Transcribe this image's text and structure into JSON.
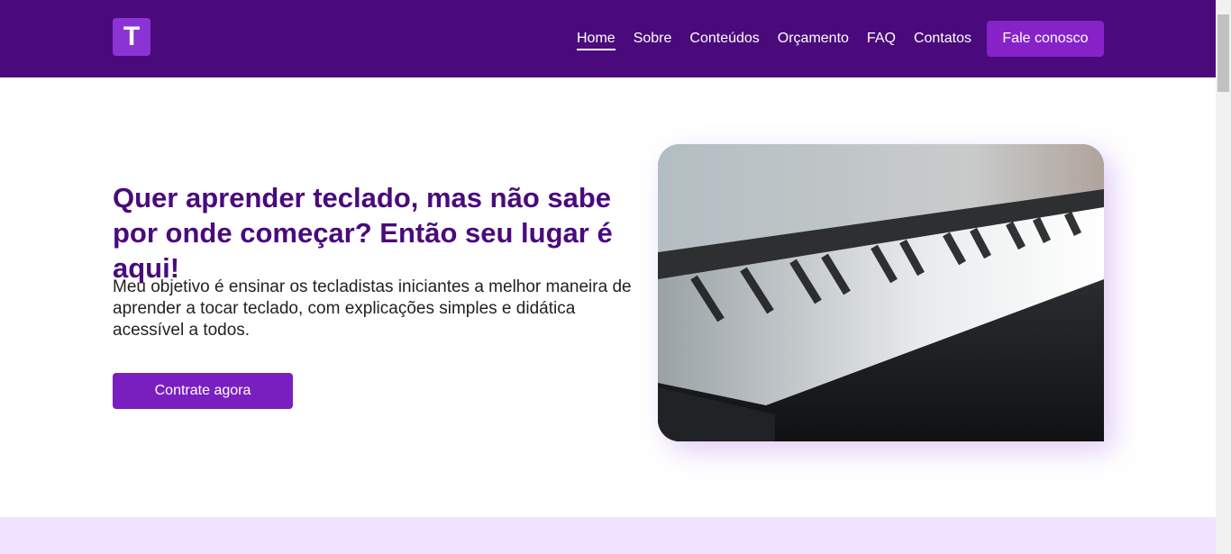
{
  "header": {
    "logo_letter": "T",
    "nav": [
      {
        "label": "Home",
        "active": true
      },
      {
        "label": "Sobre"
      },
      {
        "label": "Conteúdos"
      },
      {
        "label": "Orçamento"
      },
      {
        "label": "FAQ"
      },
      {
        "label": "Contatos"
      }
    ],
    "cta_label": "Fale conosco"
  },
  "hero": {
    "title": "Quer aprender teclado, mas não sabe por onde começar? Então seu lugar é aqui!",
    "text": "Meu objetivo é ensinar os tecladistas iniciantes a melhor maneira de aprender a tocar teclado, com explicações simples e didática acessível a todos.",
    "button_label": "Contrate agora"
  },
  "colors": {
    "header_bg": "#4a0a7c",
    "accent": "#8722c9",
    "title": "#4a0a7c",
    "band": "#f1e3ff"
  }
}
